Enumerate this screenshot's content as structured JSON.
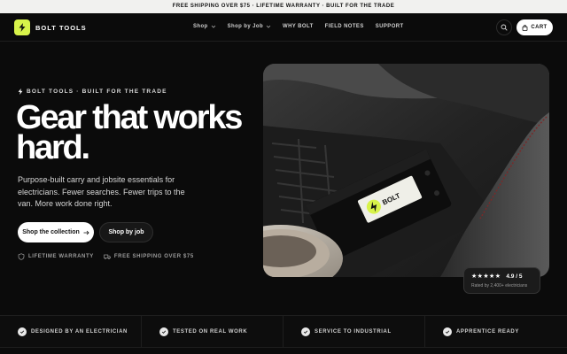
{
  "announcement": "FREE SHIPPING OVER $75 · LIFETIME WARRANTY · BUILT FOR THE TRADE",
  "brand": {
    "name": "BOLT TOOLS",
    "accent": "#d8f34a"
  },
  "nav": {
    "items": [
      {
        "label": "Shop",
        "dropdown": true
      },
      {
        "label": "Shop by Job",
        "dropdown": true
      },
      {
        "label": "WHY BOLT",
        "dropdown": false
      },
      {
        "label": "FIELD NOTES",
        "dropdown": false
      },
      {
        "label": "SUPPORT",
        "dropdown": false
      }
    ],
    "cart_label": "CART"
  },
  "hero": {
    "eyebrow": "BOLT TOOLS · BUILT FOR THE TRADE",
    "headline": "Gear that works hard.",
    "subtext": "Purpose-built carry and jobsite essentials for electricians. Fewer searches. Fewer trips to the van. More work done right.",
    "cta_primary": "Shop the collection",
    "cta_secondary": "Shop by job",
    "trust": [
      "LIFETIME WARRANTY",
      "FREE SHIPPING OVER $75"
    ],
    "product_label": "BOLT",
    "rating": {
      "stars": "★★★★★",
      "score": "4.9 / 5",
      "subtext": "Rated by 2,400+ electricians"
    }
  },
  "features": [
    "DESIGNED BY AN ELECTRICIAN",
    "TESTED ON REAL WORK",
    "SERVICE TO INDUSTRIAL",
    "APPRENTICE READY"
  ],
  "icons": {
    "logo": "bolt-icon",
    "search": "search-icon",
    "cart": "bag-icon",
    "eyebrow": "bolt-icon",
    "cta_arrow": "arrow-right-icon",
    "warranty": "shield-icon",
    "shipping": "truck-icon",
    "feature": "check-circle-icon"
  }
}
